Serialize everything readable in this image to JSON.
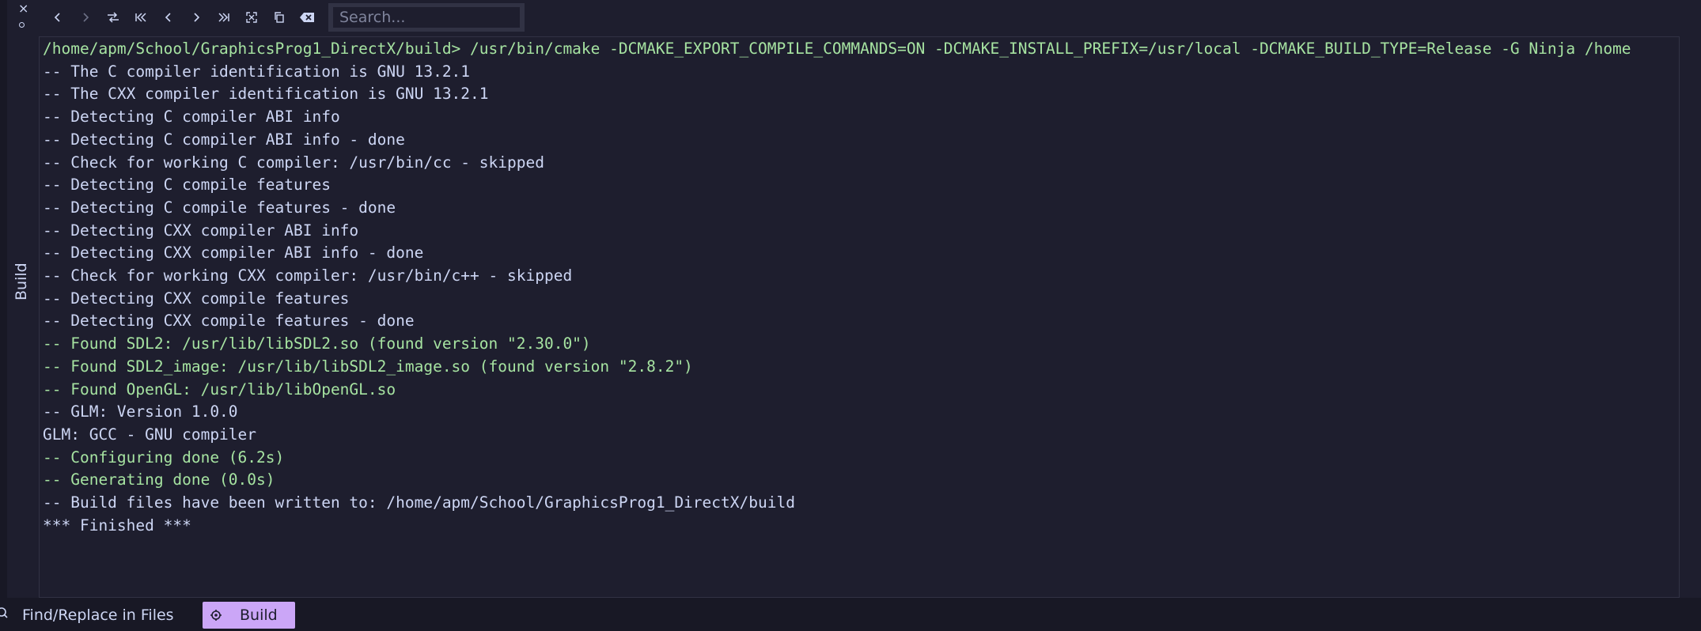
{
  "panel": {
    "close_glyph": "×",
    "side_label": "Build"
  },
  "toolbar": {
    "buttons": [
      {
        "name": "nav-back-icon"
      },
      {
        "name": "nav-forward-icon"
      },
      {
        "name": "toggle-sort-icon"
      },
      {
        "name": "first-entry-icon"
      },
      {
        "name": "previous-entry-icon"
      },
      {
        "name": "next-entry-icon"
      },
      {
        "name": "last-entry-icon"
      },
      {
        "name": "expand-icon"
      },
      {
        "name": "copy-icon"
      },
      {
        "name": "clear-icon"
      }
    ],
    "search_placeholder": "Search..."
  },
  "output": {
    "lines": [
      {
        "text": "/home/apm/School/GraphicsProg1_DirectX/build> /usr/bin/cmake -DCMAKE_EXPORT_COMPILE_COMMANDS=ON -DCMAKE_INSTALL_PREFIX=/usr/local -DCMAKE_BUILD_TYPE=Release -G Ninja /home",
        "color": "green"
      },
      {
        "text": "-- The C compiler identification is GNU 13.2.1",
        "color": "white"
      },
      {
        "text": "-- The CXX compiler identification is GNU 13.2.1",
        "color": "white"
      },
      {
        "text": "-- Detecting C compiler ABI info",
        "color": "white"
      },
      {
        "text": "-- Detecting C compiler ABI info - done",
        "color": "white"
      },
      {
        "text": "-- Check for working C compiler: /usr/bin/cc - skipped",
        "color": "white"
      },
      {
        "text": "-- Detecting C compile features",
        "color": "white"
      },
      {
        "text": "-- Detecting C compile features - done",
        "color": "white"
      },
      {
        "text": "-- Detecting CXX compiler ABI info",
        "color": "white"
      },
      {
        "text": "-- Detecting CXX compiler ABI info - done",
        "color": "white"
      },
      {
        "text": "-- Check for working CXX compiler: /usr/bin/c++ - skipped",
        "color": "white"
      },
      {
        "text": "-- Detecting CXX compile features",
        "color": "white"
      },
      {
        "text": "-- Detecting CXX compile features - done",
        "color": "white"
      },
      {
        "text": "-- Found SDL2: /usr/lib/libSDL2.so (found version \"2.30.0\")",
        "color": "green"
      },
      {
        "text": "-- Found SDL2_image: /usr/lib/libSDL2_image.so (found version \"2.8.2\")",
        "color": "green"
      },
      {
        "text": "-- Found OpenGL: /usr/lib/libOpenGL.so",
        "color": "green"
      },
      {
        "text": "-- GLM: Version 1.0.0",
        "color": "white"
      },
      {
        "text": "GLM: GCC - GNU compiler",
        "color": "white"
      },
      {
        "text": "-- Configuring done (6.2s)",
        "color": "green"
      },
      {
        "text": "-- Generating done (0.0s)",
        "color": "green"
      },
      {
        "text": "-- Build files have been written to: /home/apm/School/GraphicsProg1_DirectX/build",
        "color": "white"
      },
      {
        "text": "*** Finished ***",
        "color": "white"
      }
    ]
  },
  "bottom_tabs": {
    "find_label": "Find/Replace in Files",
    "build_label": "Build"
  },
  "colors": {
    "background": "#1e1e2e",
    "text": "#cdd6f4",
    "success_text": "#a6e3a1",
    "active_tab": "#cba6f7",
    "border": "#313244"
  }
}
